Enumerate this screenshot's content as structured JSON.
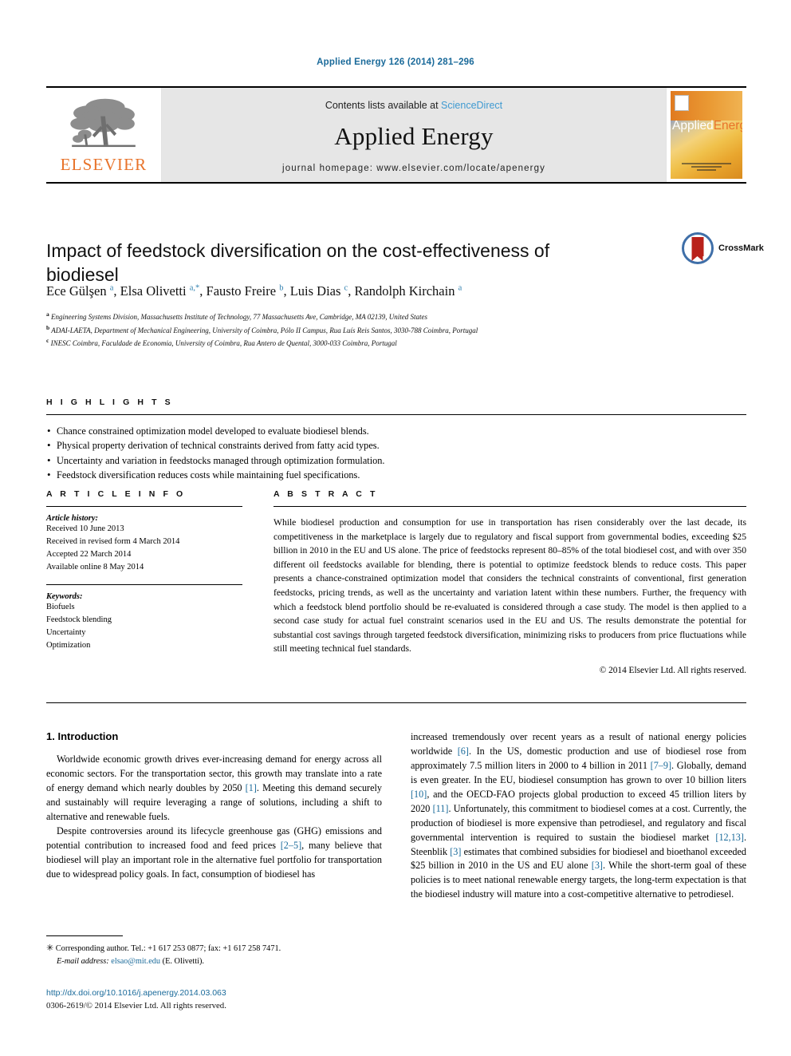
{
  "running_head": "Applied Energy 126 (2014) 281–296",
  "masthead": {
    "publisher_logo_text": "ELSEVIER",
    "contents_prefix": "Contents lists available at ",
    "contents_link": "ScienceDirect",
    "journal_name": "Applied Energy",
    "homepage": "journal homepage: www.elsevier.com/locate/apenergy",
    "cover_title_part1": "Applied",
    "cover_title_part2": "Energy"
  },
  "article": {
    "title": "Impact of feedstock diversification on the cost-effectiveness of biodiesel",
    "crossmark_label": "CrossMark",
    "authors_html": "Ece Gülşen <sup>a</sup>, Elsa Olivetti <sup>a,*</sup>, Fausto Freire <sup>b</sup>, Luis Dias <sup>c</sup>, Randolph Kirchain <sup>a</sup>",
    "affiliations": [
      "Engineering Systems Division, Massachusetts Institute of Technology, 77 Massachusetts Ave, Cambridge, MA 02139, United States",
      "ADAI-LAETA, Department of Mechanical Engineering, University of Coimbra, Pólo II Campus, Rua Luís Reis Santos, 3030-788 Coimbra, Portugal",
      "INESC Coimbra, Faculdade de Economia, University of Coimbra, Rua Antero de Quental, 3000-033 Coimbra, Portugal"
    ],
    "affiliation_marks": [
      "a",
      "b",
      "c"
    ]
  },
  "highlights": {
    "heading": "H I G H L I G H T S",
    "items": [
      "Chance constrained optimization model developed to evaluate biodiesel blends.",
      "Physical property derivation of technical constraints derived from fatty acid types.",
      "Uncertainty and variation in feedstocks managed through optimization formulation.",
      "Feedstock diversification reduces costs while maintaining fuel specifications."
    ]
  },
  "article_info": {
    "heading": "A R T I C L E    I N F O",
    "history_label": "Article history:",
    "history": [
      "Received 10 June 2013",
      "Received in revised form 4 March 2014",
      "Accepted 22 March 2014",
      "Available online 8 May 2014"
    ],
    "keywords_label": "Keywords:",
    "keywords": [
      "Biofuels",
      "Feedstock blending",
      "Uncertainty",
      "Optimization"
    ]
  },
  "abstract": {
    "heading": "A B S T R A C T",
    "text": "While biodiesel production and consumption for use in transportation has risen considerably over the last decade, its competitiveness in the marketplace is largely due to regulatory and fiscal support from governmental bodies, exceeding $25 billion in 2010 in the EU and US alone. The price of feedstocks represent 80–85% of the total biodiesel cost, and with over 350 different oil feedstocks available for blending, there is potential to optimize feedstock blends to reduce costs. This paper presents a chance-constrained optimization model that considers the technical constraints of conventional, first generation feedstocks, pricing trends, as well as the uncertainty and variation latent within these numbers. Further, the frequency with which a feedstock blend portfolio should be re-evaluated is considered through a case study. The model is then applied to a second case study for actual fuel constraint scenarios used in the EU and US. The results demonstrate the potential for substantial cost savings through targeted feedstock diversification, minimizing risks to producers from price fluctuations while still meeting technical fuel standards.",
    "copyright": "© 2014 Elsevier Ltd. All rights reserved."
  },
  "body": {
    "section_heading": "1. Introduction",
    "left_paragraphs": [
      "Worldwide economic growth drives ever-increasing demand for energy across all economic sectors. For the transportation sector, this growth may translate into a rate of energy demand which nearly doubles by 2050 [1]. Meeting this demand securely and sustainably will require leveraging a range of solutions, including a shift to alternative and renewable fuels.",
      "Despite controversies around its lifecycle greenhouse gas (GHG) emissions and potential contribution to increased food and feed prices [2–5], many believe that biodiesel will play an important role in the alternative fuel portfolio for transportation due to widespread policy goals. In fact, consumption of biodiesel has"
    ],
    "right_paragraphs": [
      "increased tremendously over recent years as a result of national energy policies worldwide [6]. In the US, domestic production and use of biodiesel rose from approximately 7.5 million liters in 2000 to 4 billion in 2011 [7–9]. Globally, demand is even greater. In the EU, biodiesel consumption has grown to over 10 billion liters [10], and the OECD-FAO projects global production to exceed 45 trillion liters by 2020 [11]. Unfortunately, this commitment to biodiesel comes at a cost. Currently, the production of biodiesel is more expensive than petrodiesel, and regulatory and fiscal governmental intervention is required to sustain the biodiesel market [12,13]. Steenblik [3] estimates that combined subsidies for biodiesel and bioethanol exceeded $25 billion in 2010 in the US and EU alone [3]. While the short-term goal of these policies is to meet national renewable energy targets, the long-term expectation is that the biodiesel industry will mature into a cost-competitive alternative to petrodiesel."
    ]
  },
  "footnotes": {
    "corresponding": "Corresponding author. Tel.: +1 617 253 0877; fax: +1 617 258 7471.",
    "email_label": "E-mail address:",
    "email": "elsao@mit.edu",
    "email_owner": "(E. Olivetti).",
    "doi": "http://dx.doi.org/10.1016/j.apenergy.2014.03.063",
    "issn_line": "0306-2619/© 2014 Elsevier Ltd. All rights reserved."
  },
  "colors": {
    "link_blue": "#1a6a9a",
    "sciencedirect_blue": "#3f9ad1",
    "elsevier_orange": "#E8732A",
    "crossmark_red": "#b9211a",
    "crossmark_blue": "#3f6fa8"
  }
}
